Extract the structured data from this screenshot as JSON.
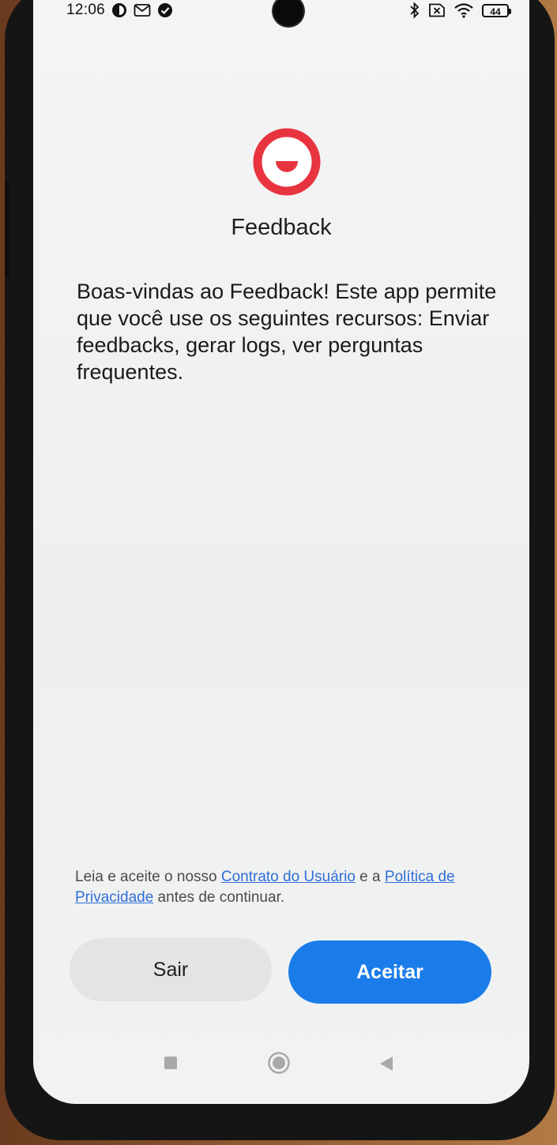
{
  "status_bar": {
    "time": "12:06",
    "left_icons": [
      "notification-app-icon",
      "gmail-icon",
      "check-circle-icon"
    ],
    "right_icons": [
      "bluetooth-icon",
      "sim-off-icon",
      "wifi-icon",
      "battery-icon"
    ],
    "battery_level": "44"
  },
  "app": {
    "logo_icon": "feedback-smile-icon",
    "logo_color": "#e8343f",
    "title": "Feedback"
  },
  "welcome_text": "Boas-vindas ao Feedback! Este app permite que você use os seguintes recursos: Enviar feedbacks, gerar logs, ver perguntas frequentes.",
  "legal": {
    "prefix": "Leia e aceite o nosso ",
    "user_agreement_link": "Contrato do Usuário",
    "middle": " e a ",
    "privacy_link": "Política de Privacidade",
    "suffix": " antes de continuar."
  },
  "buttons": {
    "exit_label": "Sair",
    "accept_label": "Aceitar",
    "accent_color": "#1a7ce8"
  },
  "nav_bar": {
    "items": [
      "recents-square-icon",
      "home-circle-icon",
      "back-triangle-icon"
    ]
  }
}
